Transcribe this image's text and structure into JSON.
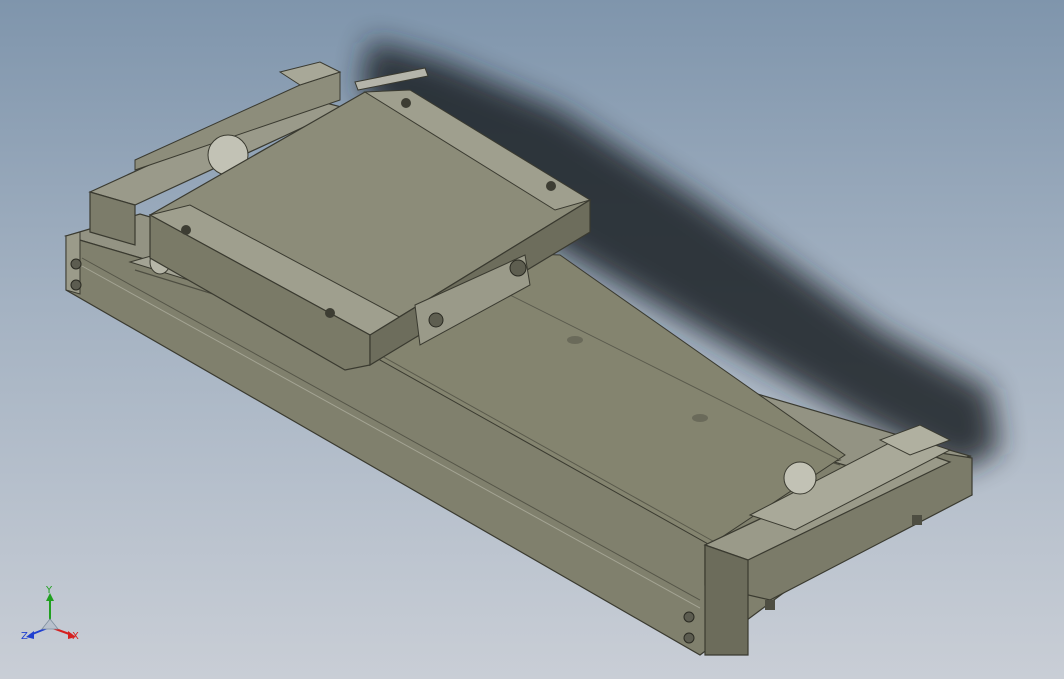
{
  "viewport": {
    "background_top": "#7f95ac",
    "background_bottom": "#c9ced6",
    "model_color": "#8b8b78"
  },
  "triad": {
    "x_label": "X",
    "y_label": "Y",
    "z_label": "Z",
    "x_color": "#d62020",
    "y_color": "#20a020",
    "z_color": "#2040d0"
  }
}
